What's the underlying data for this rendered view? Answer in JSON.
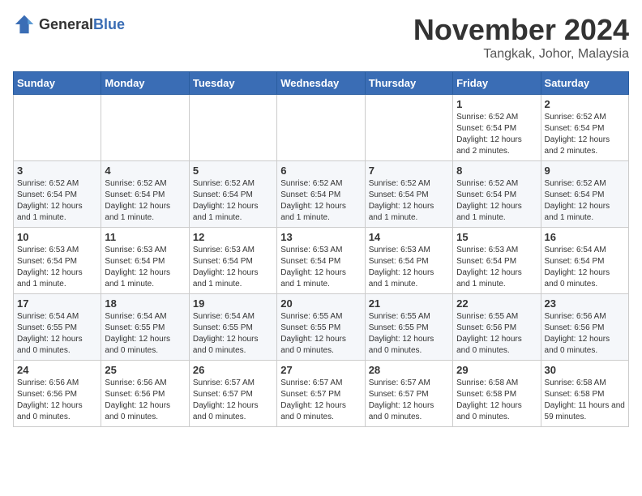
{
  "logo": {
    "general": "General",
    "blue": "Blue"
  },
  "title": {
    "month": "November 2024",
    "location": "Tangkak, Johor, Malaysia"
  },
  "header": {
    "days": [
      "Sunday",
      "Monday",
      "Tuesday",
      "Wednesday",
      "Thursday",
      "Friday",
      "Saturday"
    ]
  },
  "weeks": [
    {
      "cells": [
        {
          "day": "",
          "info": ""
        },
        {
          "day": "",
          "info": ""
        },
        {
          "day": "",
          "info": ""
        },
        {
          "day": "",
          "info": ""
        },
        {
          "day": "",
          "info": ""
        },
        {
          "day": "1",
          "info": "Sunrise: 6:52 AM\nSunset: 6:54 PM\nDaylight: 12 hours and 2 minutes."
        },
        {
          "day": "2",
          "info": "Sunrise: 6:52 AM\nSunset: 6:54 PM\nDaylight: 12 hours and 2 minutes."
        }
      ]
    },
    {
      "cells": [
        {
          "day": "3",
          "info": "Sunrise: 6:52 AM\nSunset: 6:54 PM\nDaylight: 12 hours and 1 minute."
        },
        {
          "day": "4",
          "info": "Sunrise: 6:52 AM\nSunset: 6:54 PM\nDaylight: 12 hours and 1 minute."
        },
        {
          "day": "5",
          "info": "Sunrise: 6:52 AM\nSunset: 6:54 PM\nDaylight: 12 hours and 1 minute."
        },
        {
          "day": "6",
          "info": "Sunrise: 6:52 AM\nSunset: 6:54 PM\nDaylight: 12 hours and 1 minute."
        },
        {
          "day": "7",
          "info": "Sunrise: 6:52 AM\nSunset: 6:54 PM\nDaylight: 12 hours and 1 minute."
        },
        {
          "day": "8",
          "info": "Sunrise: 6:52 AM\nSunset: 6:54 PM\nDaylight: 12 hours and 1 minute."
        },
        {
          "day": "9",
          "info": "Sunrise: 6:52 AM\nSunset: 6:54 PM\nDaylight: 12 hours and 1 minute."
        }
      ]
    },
    {
      "cells": [
        {
          "day": "10",
          "info": "Sunrise: 6:53 AM\nSunset: 6:54 PM\nDaylight: 12 hours and 1 minute."
        },
        {
          "day": "11",
          "info": "Sunrise: 6:53 AM\nSunset: 6:54 PM\nDaylight: 12 hours and 1 minute."
        },
        {
          "day": "12",
          "info": "Sunrise: 6:53 AM\nSunset: 6:54 PM\nDaylight: 12 hours and 1 minute."
        },
        {
          "day": "13",
          "info": "Sunrise: 6:53 AM\nSunset: 6:54 PM\nDaylight: 12 hours and 1 minute."
        },
        {
          "day": "14",
          "info": "Sunrise: 6:53 AM\nSunset: 6:54 PM\nDaylight: 12 hours and 1 minute."
        },
        {
          "day": "15",
          "info": "Sunrise: 6:53 AM\nSunset: 6:54 PM\nDaylight: 12 hours and 1 minute."
        },
        {
          "day": "16",
          "info": "Sunrise: 6:54 AM\nSunset: 6:54 PM\nDaylight: 12 hours and 0 minutes."
        }
      ]
    },
    {
      "cells": [
        {
          "day": "17",
          "info": "Sunrise: 6:54 AM\nSunset: 6:55 PM\nDaylight: 12 hours and 0 minutes."
        },
        {
          "day": "18",
          "info": "Sunrise: 6:54 AM\nSunset: 6:55 PM\nDaylight: 12 hours and 0 minutes."
        },
        {
          "day": "19",
          "info": "Sunrise: 6:54 AM\nSunset: 6:55 PM\nDaylight: 12 hours and 0 minutes."
        },
        {
          "day": "20",
          "info": "Sunrise: 6:55 AM\nSunset: 6:55 PM\nDaylight: 12 hours and 0 minutes."
        },
        {
          "day": "21",
          "info": "Sunrise: 6:55 AM\nSunset: 6:55 PM\nDaylight: 12 hours and 0 minutes."
        },
        {
          "day": "22",
          "info": "Sunrise: 6:55 AM\nSunset: 6:56 PM\nDaylight: 12 hours and 0 minutes."
        },
        {
          "day": "23",
          "info": "Sunrise: 6:56 AM\nSunset: 6:56 PM\nDaylight: 12 hours and 0 minutes."
        }
      ]
    },
    {
      "cells": [
        {
          "day": "24",
          "info": "Sunrise: 6:56 AM\nSunset: 6:56 PM\nDaylight: 12 hours and 0 minutes."
        },
        {
          "day": "25",
          "info": "Sunrise: 6:56 AM\nSunset: 6:56 PM\nDaylight: 12 hours and 0 minutes."
        },
        {
          "day": "26",
          "info": "Sunrise: 6:57 AM\nSunset: 6:57 PM\nDaylight: 12 hours and 0 minutes."
        },
        {
          "day": "27",
          "info": "Sunrise: 6:57 AM\nSunset: 6:57 PM\nDaylight: 12 hours and 0 minutes."
        },
        {
          "day": "28",
          "info": "Sunrise: 6:57 AM\nSunset: 6:57 PM\nDaylight: 12 hours and 0 minutes."
        },
        {
          "day": "29",
          "info": "Sunrise: 6:58 AM\nSunset: 6:58 PM\nDaylight: 12 hours and 0 minutes."
        },
        {
          "day": "30",
          "info": "Sunrise: 6:58 AM\nSunset: 6:58 PM\nDaylight: 11 hours and 59 minutes."
        }
      ]
    }
  ]
}
